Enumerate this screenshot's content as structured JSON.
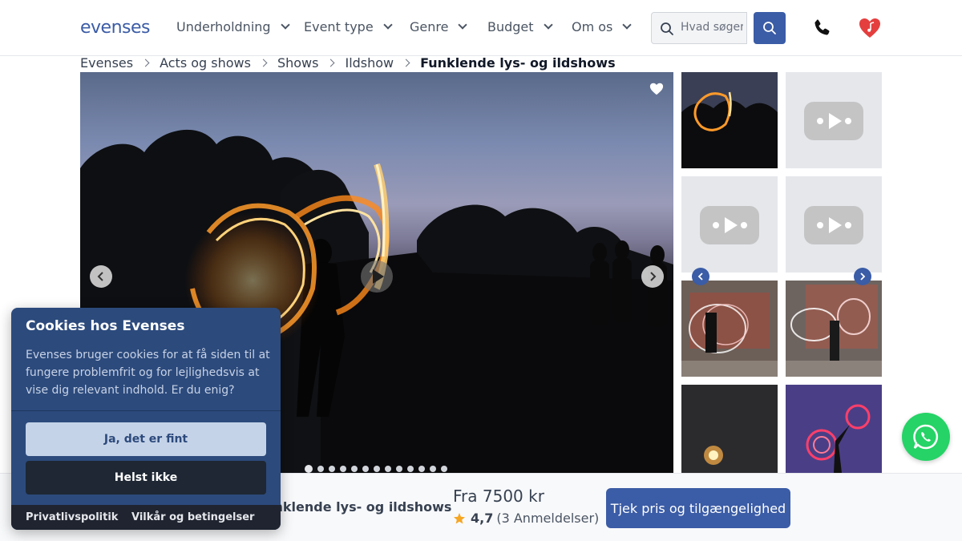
{
  "brand": {
    "logo": "evenses",
    "accent": "#3b5ca6"
  },
  "nav": {
    "items": [
      {
        "label": "Underholdning"
      },
      {
        "label": "Event type"
      },
      {
        "label": "Genre"
      },
      {
        "label": "Budget"
      },
      {
        "label": "Om os"
      }
    ],
    "search_placeholder": "Hvad søger du?"
  },
  "breadcrumb": [
    "Evenses",
    "Acts og shows",
    "Shows",
    "Ildshow",
    "Funklende lys- og ildshows"
  ],
  "gallery": {
    "main_image": "fire-poi-performer-at-dusk",
    "dots_count": 13,
    "active_dot": 0,
    "thumbnails": [
      {
        "kind": "image",
        "subject": "fire-poi-at-dusk"
      },
      {
        "kind": "video"
      },
      {
        "kind": "video"
      },
      {
        "kind": "video"
      },
      {
        "kind": "image",
        "subject": "led-poi-show-indoors"
      },
      {
        "kind": "image",
        "subject": "led-poi-show-on-stage"
      },
      {
        "kind": "image",
        "subject": "fire-performer-dark"
      },
      {
        "kind": "image",
        "subject": "led-poi-silhouette-purple"
      }
    ]
  },
  "bottom_bar": {
    "title": "Funklende lys- og ildshows",
    "price": "Fra 7500 kr",
    "rating": "4,7",
    "reviews": "(3 Anmeldelser)",
    "cta": "Tjek pris og tilgængelighed"
  },
  "cookie": {
    "title": "Cookies hos Evenses",
    "body": "Evenses bruger cookies for at få siden til at fungere problemfrit og for lejlighedsvis at vise dig relevant indhold. Er du enig?",
    "accept": "Ja, det er fint",
    "decline": "Helst ikke",
    "privacy": "Privatlivspolitik",
    "terms": "Vilkår og betingelser"
  },
  "colors": {
    "star": "#f5a623",
    "whatsapp": "#25d366",
    "heart": "#e53e3e"
  }
}
